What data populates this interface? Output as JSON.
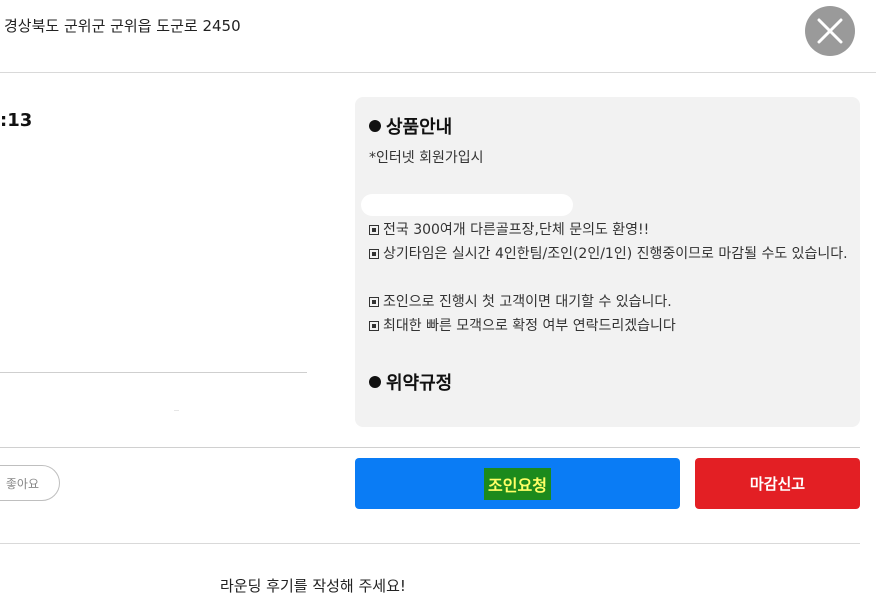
{
  "header": {
    "address": "경상북도 군위군 군위읍 도군로 2450",
    "close_icon": "close-icon"
  },
  "left": {
    "time": ":13"
  },
  "product_info": {
    "heading": "상품안내",
    "signup_note": "*인터넷 회원가입시",
    "lines": [
      "전국 300여개 다른골프장,단체 문의도 환영!!",
      "상기타임은 실시간 4인한팀/조인(2인/1인) 진행중이므로 마감될 수도 있습니다.",
      "조인으로 진행시 첫 고객이면 대기할 수 있습니다.",
      "최대한 빠른 모객으로 확정 여부 연락드리겠습니다"
    ],
    "terms_heading": "위약규정"
  },
  "actions": {
    "like_label": "좋아요",
    "join_label": "조인요청",
    "report_label": "마감신고"
  },
  "footer": {
    "review_prompt": "라운딩 후기를 작성해 주세요!"
  },
  "colors": {
    "join_button": "#0a7cf5",
    "report_button": "#e31f24",
    "info_box": "#f2f2f2"
  }
}
